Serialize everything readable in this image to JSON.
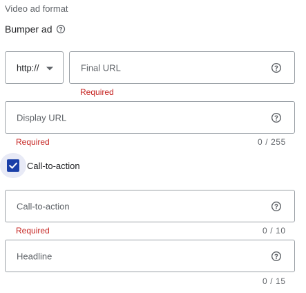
{
  "section": {
    "label": "Video ad format"
  },
  "format": {
    "value": "Bumper ad"
  },
  "protocol": {
    "value": "http://"
  },
  "final_url": {
    "placeholder": "Final URL",
    "error": "Required"
  },
  "display_url": {
    "placeholder": "Display URL",
    "error": "Required",
    "counter": "0 / 255"
  },
  "cta_checkbox": {
    "label": "Call-to-action",
    "checked": true
  },
  "cta_field": {
    "placeholder": "Call-to-action",
    "error": "Required",
    "counter": "0 / 10"
  },
  "headline": {
    "placeholder": "Headline",
    "counter": "0 / 15"
  },
  "colors": {
    "border": "#9aa0a6",
    "error": "#c5221f",
    "checkbox": "#1a3fa8",
    "muted": "#5f6368"
  },
  "icons": {
    "help": "help-circle-icon",
    "dropdown": "caret-down-icon",
    "check": "check-icon"
  }
}
